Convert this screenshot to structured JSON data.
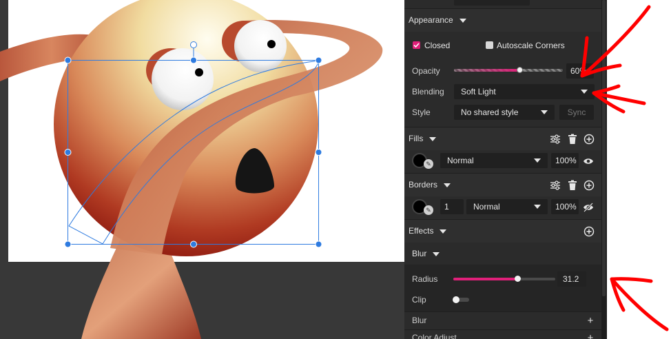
{
  "appearance": {
    "title": "Appearance",
    "closed_label": "Closed",
    "closed_checked": true,
    "autoscale_label": "Autoscale Corners",
    "autoscale_checked": false,
    "opacity_label": "Opacity",
    "opacity_value": "60%",
    "opacity_fraction": 0.6,
    "blending_label": "Blending",
    "blending_value": "Soft Light",
    "style_label": "Style",
    "style_value": "No shared style",
    "sync_label": "Sync"
  },
  "fills": {
    "title": "Fills",
    "blend_value": "Normal",
    "opacity_value": "100%",
    "color": "#000000"
  },
  "borders": {
    "title": "Borders",
    "width_value": "1",
    "blend_value": "Normal",
    "opacity_value": "100%",
    "color": "#000000"
  },
  "effects": {
    "title": "Effects",
    "blur": {
      "title": "Blur",
      "radius_label": "Radius",
      "radius_value": "31.2",
      "radius_fraction": 0.63,
      "clip_label": "Clip",
      "clip_on": false
    },
    "add_blur_label": "Blur",
    "add_color_adjust_label": "Color Adjust"
  },
  "colors": {
    "accent_pink": "#e0207a",
    "annotation_red": "#ff0000",
    "selection_blue": "#2e7be0"
  },
  "icons": {
    "fills_adjust": "sliders-icon",
    "fills_delete": "trash-icon",
    "fills_add": "plus-circle-icon",
    "fills_visible": "eye-icon",
    "borders_visible": "eye-off-icon"
  }
}
